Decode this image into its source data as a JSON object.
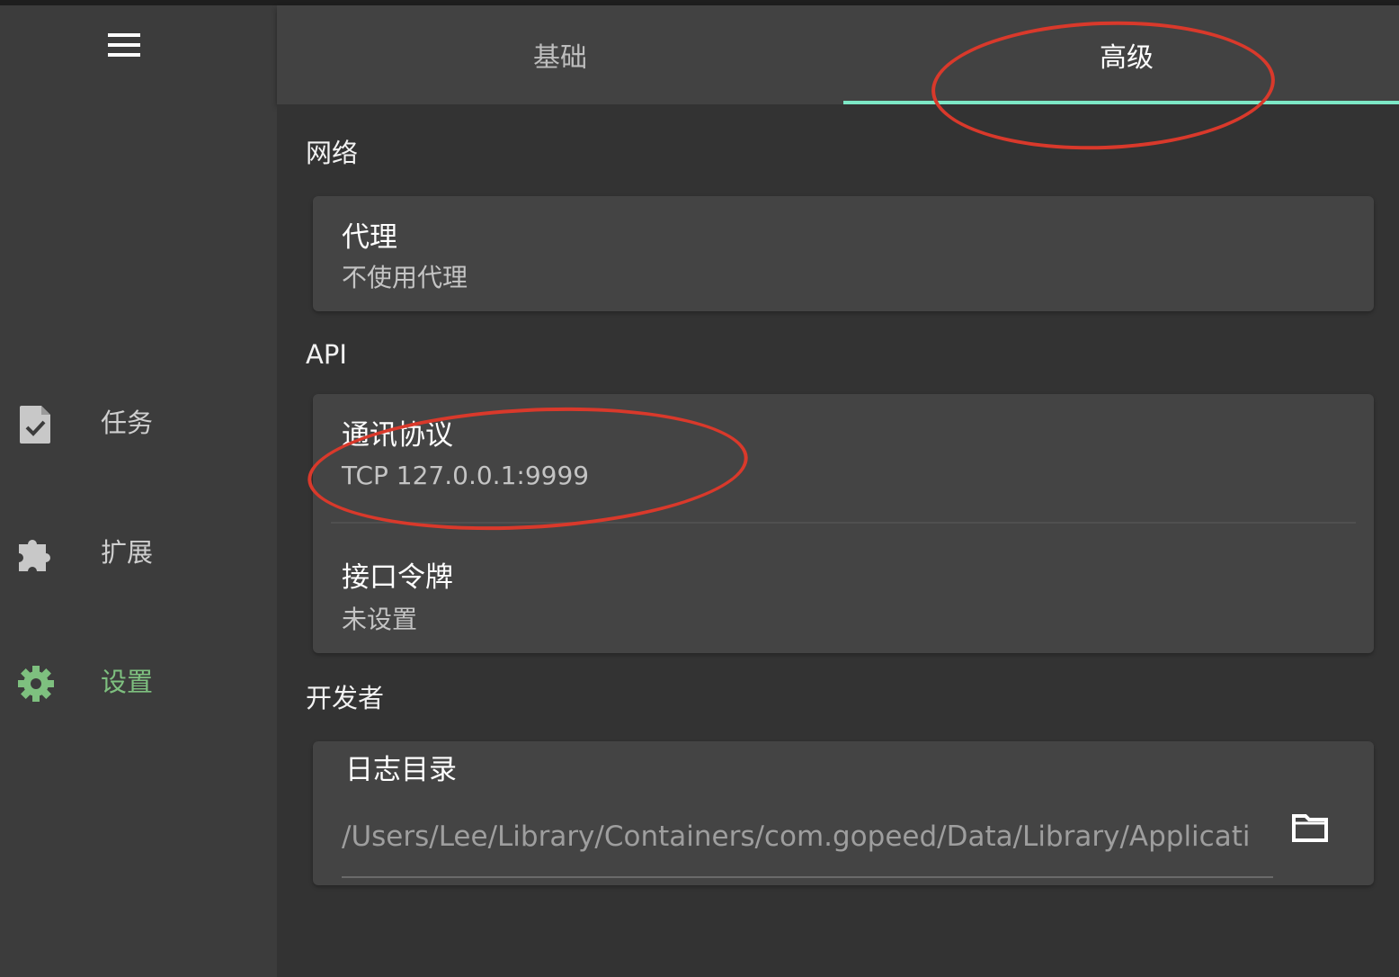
{
  "sidebar": {
    "menu_icon": "hamburger-menu-icon",
    "items": [
      {
        "label": "任务",
        "icon": "task-file-check-icon",
        "active": false
      },
      {
        "label": "扩展",
        "icon": "puzzle-extension-icon",
        "active": false
      },
      {
        "label": "设置",
        "icon": "gear-settings-icon",
        "active": true
      }
    ]
  },
  "tabs": [
    {
      "label": "基础",
      "active": false
    },
    {
      "label": "高级",
      "active": true
    }
  ],
  "sections": {
    "network": {
      "title": "网络",
      "proxy": {
        "title": "代理",
        "value": "不使用代理"
      }
    },
    "api": {
      "title": "API",
      "protocol": {
        "title": "通讯协议",
        "value": "TCP 127.0.0.1:9999"
      },
      "token": {
        "title": "接口令牌",
        "value": "未设置"
      }
    },
    "developer": {
      "title": "开发者",
      "log_dir": {
        "title": "日志目录",
        "value": "/Users/Lee/Library/Containers/com.gopeed/Data/Library/Applicati",
        "button_icon": "folder-icon"
      }
    }
  },
  "colors": {
    "accent_tab": "#7de8c6",
    "active_nav": "#7ec07f",
    "annotation": "#d9392b"
  }
}
